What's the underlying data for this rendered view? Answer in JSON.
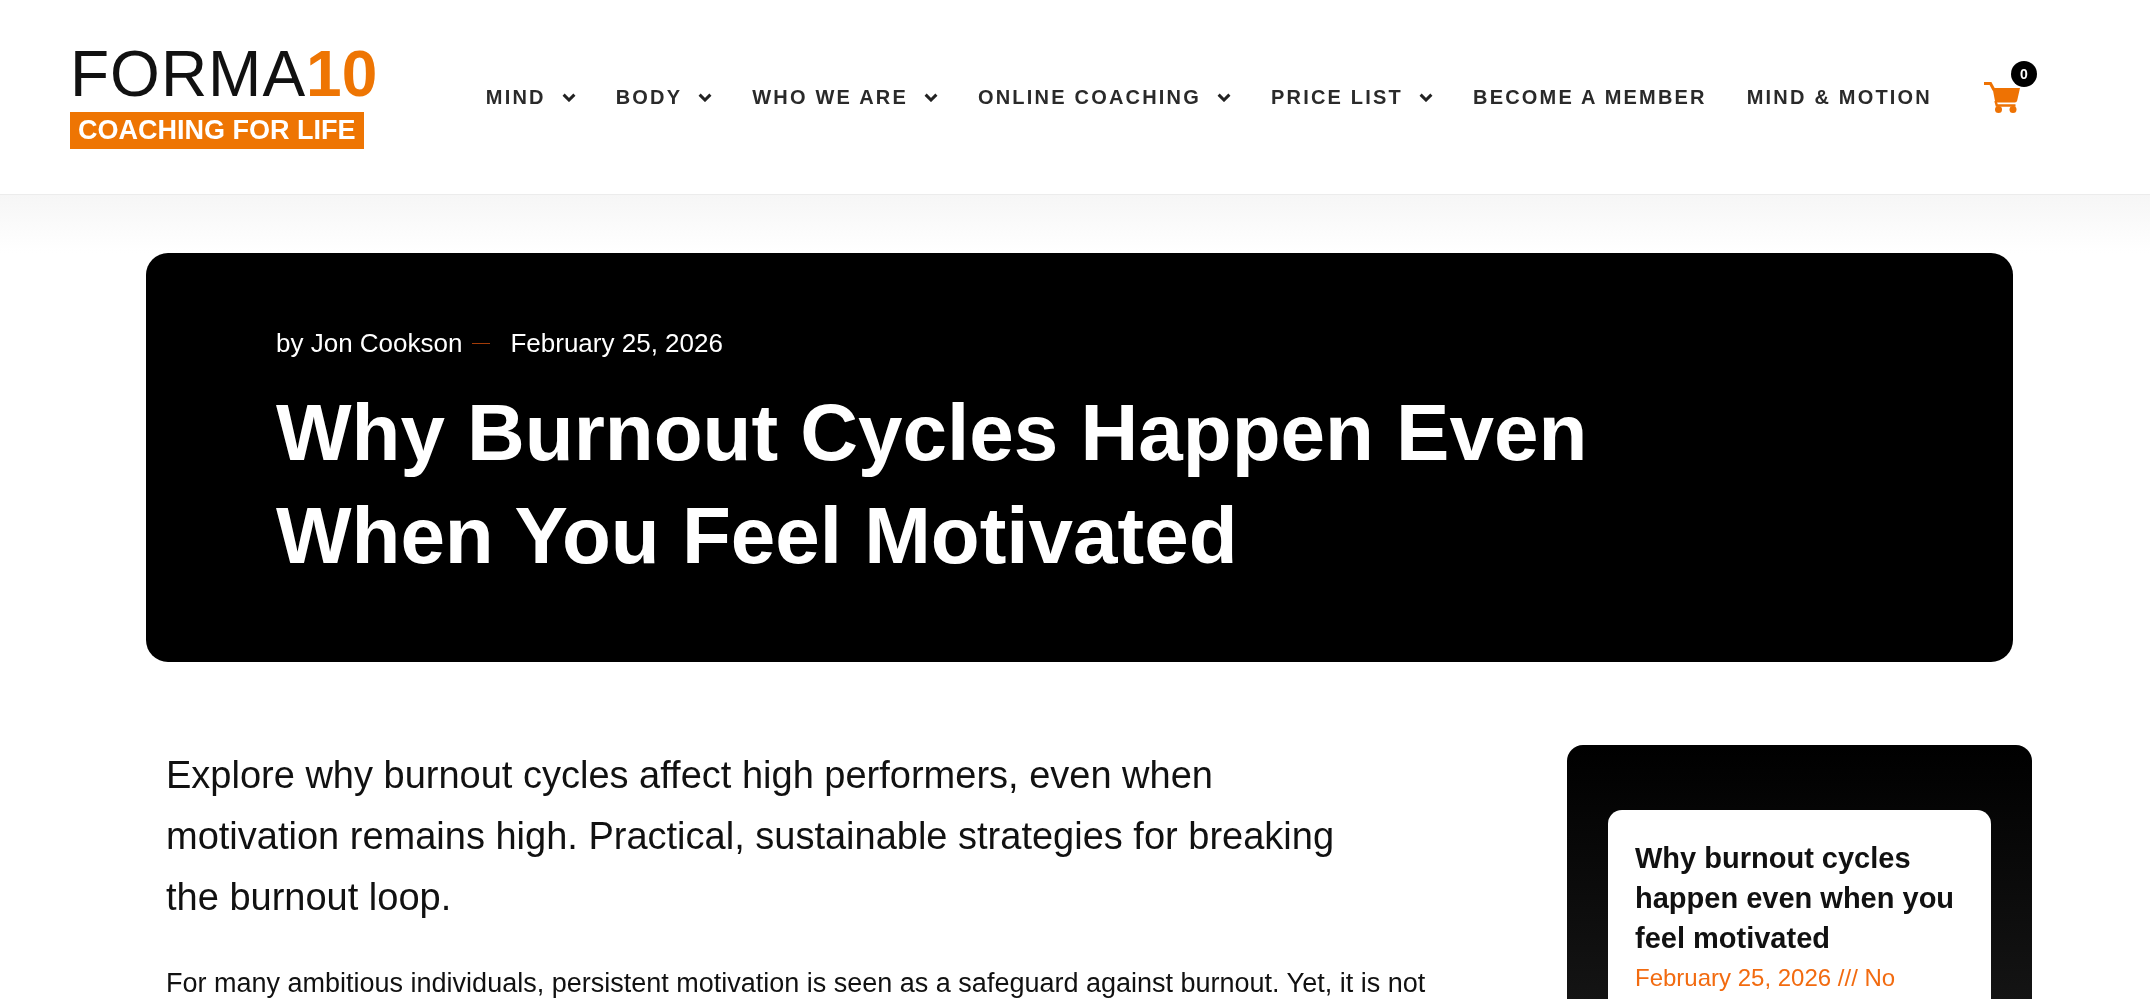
{
  "header": {
    "logo": {
      "wordmark": "FORMA",
      "number": "10",
      "tagline": "COACHING FOR LIFE"
    },
    "nav": [
      {
        "label": "MIND",
        "has_menu": true
      },
      {
        "label": "BODY",
        "has_menu": true
      },
      {
        "label": "WHO WE ARE",
        "has_menu": true
      },
      {
        "label": "ONLINE COACHING",
        "has_menu": true
      },
      {
        "label": "PRICE LIST",
        "has_menu": true
      },
      {
        "label": "BECOME A MEMBER",
        "has_menu": false
      },
      {
        "label": "MIND & MOTION",
        "has_menu": false
      }
    ],
    "cart": {
      "count": "0"
    }
  },
  "hero": {
    "author": "by Jon Cookson",
    "date": "February 25, 2026",
    "title": "Why Burnout Cycles Happen Even When You Feel Motivated"
  },
  "article": {
    "lead": "Explore why burnout cycles affect high performers, even when motivation remains high. Practical, sustainable strategies for breaking the burnout loop.",
    "paragraphs": [
      "For many ambitious individuals, persistent motivation is seen as a safeguard against burnout. Yet, it is not"
    ]
  },
  "sidebar": {
    "posts": [
      {
        "title": "Why burnout cycles happen even when you feel motivated",
        "meta": "February 25, 2026 /// No"
      }
    ]
  }
}
